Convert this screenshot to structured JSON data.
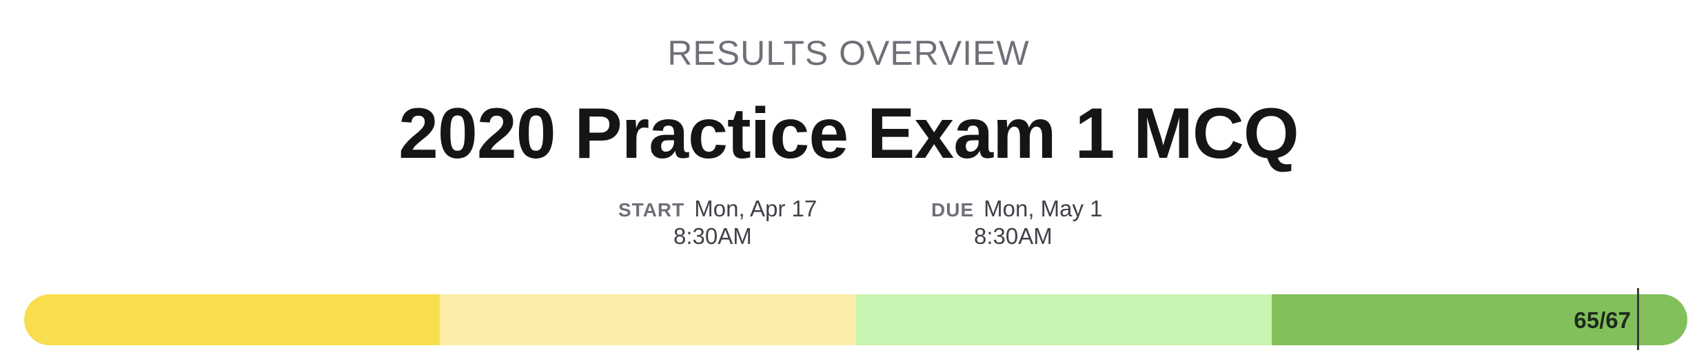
{
  "header": {
    "overline": "RESULTS OVERVIEW",
    "title": "2020 Practice Exam 1 MCQ"
  },
  "schedule": {
    "start": {
      "label": "START",
      "date": "Mon, Apr 17",
      "time": "8:30AM"
    },
    "due": {
      "label": "DUE",
      "date": "Mon, May 1",
      "time": "8:30AM"
    }
  },
  "score": {
    "text": "65/67",
    "correct": 65,
    "total": 67,
    "fraction": 0.97
  },
  "progress": {
    "segments": [
      {
        "color": "#f8dd4e"
      },
      {
        "color": "#fbeca7"
      },
      {
        "color": "#c9f3b0"
      },
      {
        "color": "#82c05b"
      }
    ]
  }
}
